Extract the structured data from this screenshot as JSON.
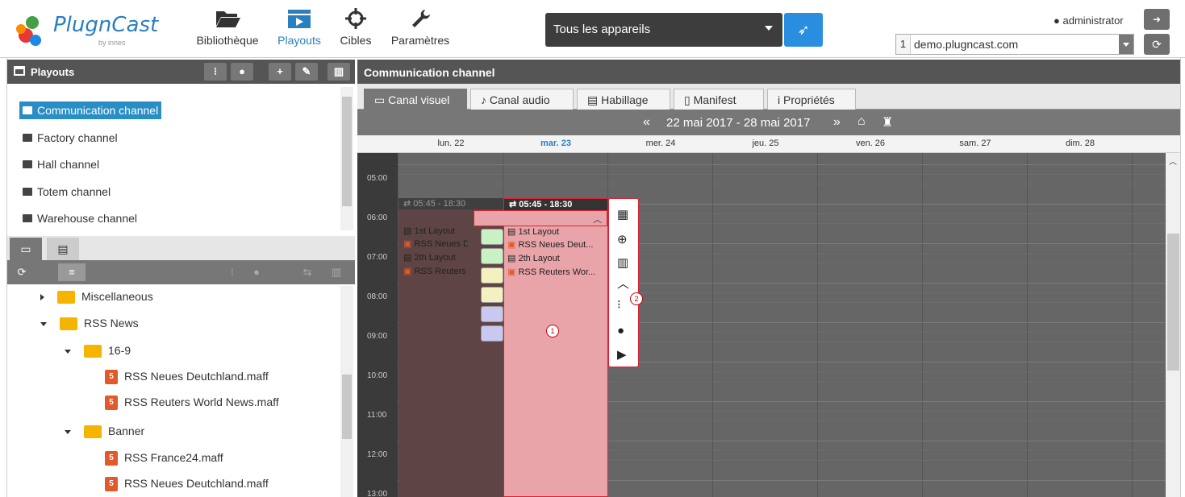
{
  "header": {
    "logo_text": "PlugnCast",
    "logo_sub": "by innes",
    "nav": [
      {
        "label": "Bibliothèque",
        "icon": "folder-open-icon"
      },
      {
        "label": "Playouts",
        "icon": "film-icon"
      },
      {
        "label": "Cibles",
        "icon": "crosshair-icon"
      },
      {
        "label": "Paramètres",
        "icon": "wrench-icon"
      }
    ],
    "device_select": "Tous les appareils",
    "user": "administrator",
    "server_index": "1",
    "server_name": "demo.plugncast.com"
  },
  "left_panel": {
    "title": "Playouts",
    "playouts": [
      "Communication channel",
      "Factory channel",
      "Hall channel",
      "Totem channel",
      "Warehouse channel"
    ],
    "tree": {
      "misc": "Miscellaneous",
      "rss_news": "RSS News",
      "f169": "16-9",
      "file1": "RSS Neues Deutchland.maff",
      "file2": "RSS Reuters World News.maff",
      "banner": "Banner",
      "file3": "RSS France24.maff",
      "file4": "RSS Neues Deutchland.maff"
    }
  },
  "right_panel": {
    "title": "Communication channel",
    "tabs": [
      "Canal visuel",
      "Canal audio",
      "Habillage",
      "Manifest",
      "Propriétés"
    ],
    "week_range": "22 mai 2017 - 28 mai 2017",
    "days": [
      "lun. 22",
      "mar. 23",
      "mer. 24",
      "jeu. 25",
      "ven. 26",
      "sam. 27",
      "dim. 28"
    ],
    "times": [
      "05:00",
      "06:00",
      "07:00",
      "08:00",
      "09:00",
      "10:00",
      "11:00",
      "12:00",
      "13:00"
    ],
    "schedule": {
      "time_range": "05:45 - 18:30",
      "mon_lines": [
        "1st Layout",
        "RSS Neues De",
        "2th Layout",
        "RSS Reuters W"
      ],
      "tue_lines": [
        "1st Layout",
        "RSS Neues Deut...",
        "2th Layout",
        "RSS Reuters Wor..."
      ]
    },
    "badges": [
      "1",
      "2"
    ]
  },
  "colors": {
    "accent": "#2a7fc1",
    "selection": "#2a8ec6",
    "schedule": "#e8a4a8",
    "schedule_border": "#dd2233"
  }
}
